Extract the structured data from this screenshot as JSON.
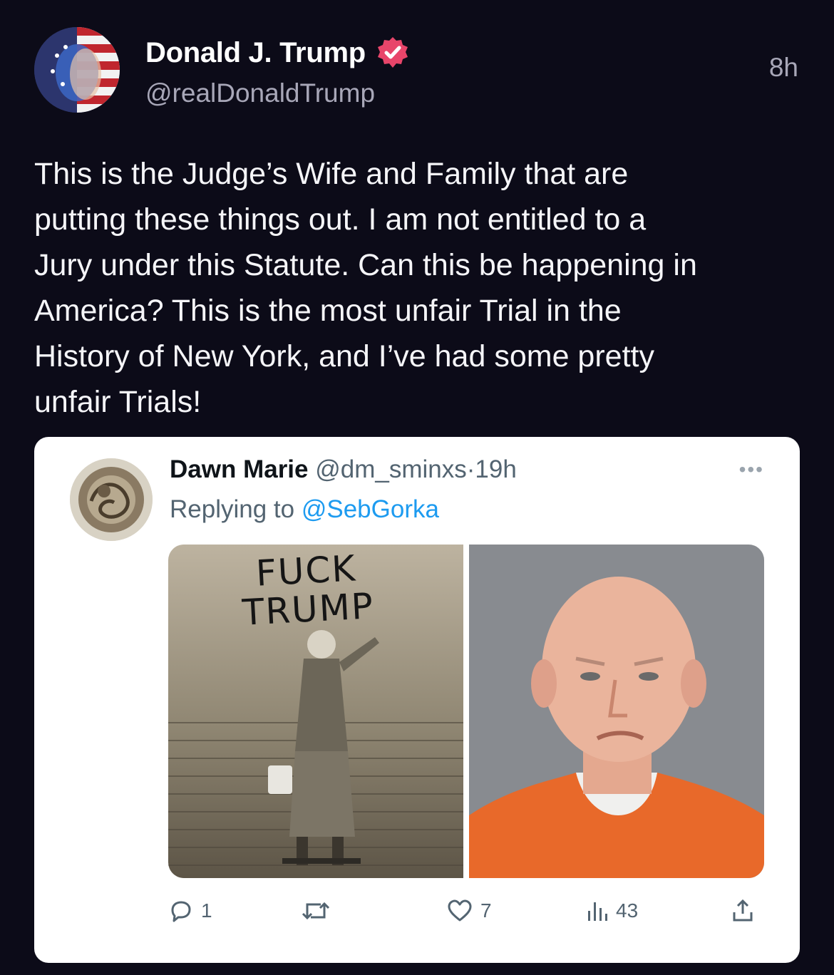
{
  "post": {
    "author_name": "Donald J. Trump",
    "author_handle": "@realDonaldTrump",
    "timestamp": "8h",
    "verified": true,
    "avatar": "user-avatar",
    "text": "This is the Judge’s Wife and Family that are\nputting these things out. I am not entitled to a\nJury under this Statute. Can this be happening in\nAmerica? This is the most unfair Trial in the\nHistory of New York, and I’ve had some pretty\nunfair Trials!"
  },
  "quote": {
    "author_name": "Dawn Marie",
    "author_handle": "@dm_sminxs",
    "separator": "·",
    "timestamp": "19h",
    "replying_prefix": "Replying to ",
    "replying_to": "@SebGorka",
    "more_icon": "more-icon",
    "media": {
      "left_graffiti_line1": "FUCK",
      "left_graffiti_line2": "TRUMP"
    },
    "actions": {
      "reply_count": "1",
      "retweet_count": "",
      "like_count": "7",
      "views_count": "43"
    }
  },
  "colors": {
    "background": "#0c0b18",
    "verified_badge": "#e8456a",
    "link": "#1d9bf0",
    "muted": "#a8a7b8"
  }
}
